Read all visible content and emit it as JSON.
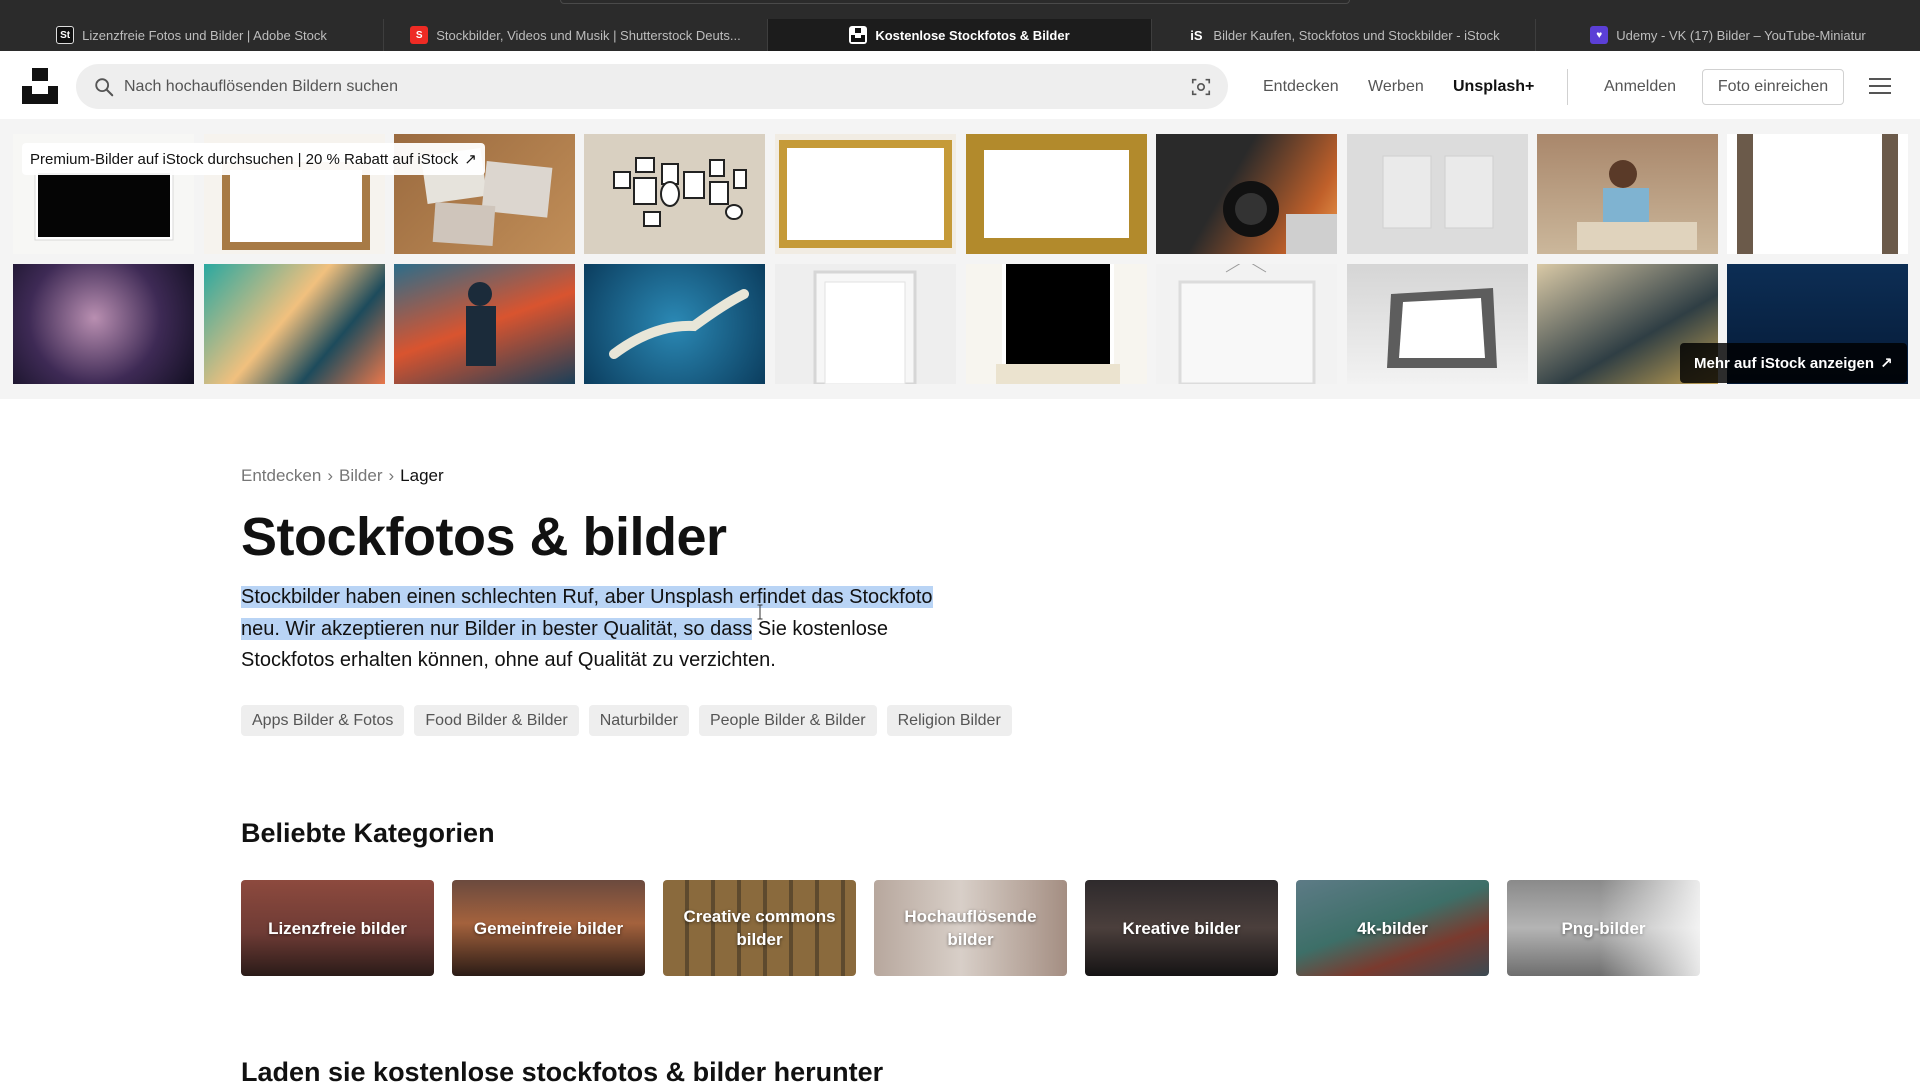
{
  "browser": {
    "tabs": [
      {
        "title": "Lizenzfreie Fotos und Bilder | Adobe Stock",
        "icon": "adobe-stock-favicon",
        "active": false
      },
      {
        "title": "Stockbilder, Videos und Musik | Shutterstock Deuts...",
        "icon": "shutterstock-favicon",
        "active": false
      },
      {
        "title": "Kostenlose Stockfotos & Bilder",
        "icon": "unsplash-favicon",
        "active": true
      },
      {
        "title": "Bilder Kaufen, Stockfotos und Stockbilder - iStock",
        "icon": "istock-favicon",
        "active": false
      },
      {
        "title": "Udemy - VK (17) Bilder – YouTube-Miniatur",
        "icon": "udemy-favicon",
        "active": false
      }
    ]
  },
  "header": {
    "search_placeholder": "Nach hochauflösenden Bildern suchen",
    "nav": [
      "Entdecken",
      "Werben",
      "Unsplash+"
    ],
    "login": "Anmelden",
    "submit": "Foto einreichen"
  },
  "istock": {
    "promo": "Premium-Bilder auf iStock durchsuchen | 20 % Rabatt auf iStock",
    "more": "Mehr auf iStock anzeigen"
  },
  "breadcrumb": [
    "Entdecken",
    "Bilder",
    "Lager"
  ],
  "page": {
    "title": "Stockfotos & bilder",
    "desc_selected": "Stockbilder haben einen schlechten Ruf, aber Unsplash erfindet das Stockfoto neu. Wir akzeptieren nur Bilder in bester Qualität, so dass",
    "desc_rest": " Sie kostenlose Stockfotos erhalten können, ohne auf Qualität zu verzichten."
  },
  "tags": [
    "Apps Bilder & Fotos",
    "Food Bilder & Bilder",
    "Naturbilder",
    "People Bilder & Bilder",
    "Religion Bilder"
  ],
  "categories": {
    "title": "Beliebte Kategorien",
    "items": [
      "Lizenzfreie bilder",
      "Gemeinfreie bilder",
      "Creative commons bilder",
      "Hochauflösende bilder",
      "Kreative bilder",
      "4k-bilder",
      "Png-bilder"
    ]
  },
  "download_title": "Laden sie kostenlose stockfotos & bilder herunter"
}
